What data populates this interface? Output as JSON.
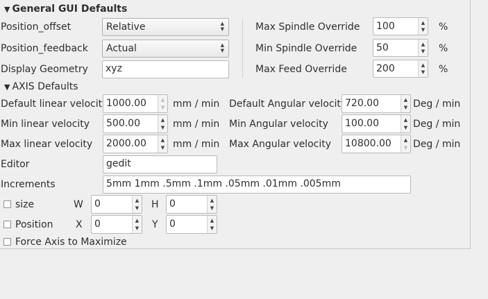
{
  "general": {
    "header": "General GUI Defaults",
    "position_offset": {
      "label": "Position_offset",
      "value": "Relative"
    },
    "position_feedback": {
      "label": "Position_feedback",
      "value": "Actual"
    },
    "display_geometry": {
      "label": "Display Geometry",
      "value": "xyz"
    },
    "max_spindle": {
      "label": "Max Spindle Override",
      "value": "100",
      "unit": "%"
    },
    "min_spindle": {
      "label": "Min Spindle Override",
      "value": "50",
      "unit": "%"
    },
    "max_feed": {
      "label": "Max Feed Override",
      "value": "200",
      "unit": "%"
    }
  },
  "axis": {
    "header": "AXIS Defaults",
    "default_linear": {
      "label": "Default linear velocity",
      "value": "1000.00",
      "unit": "mm / min"
    },
    "min_linear": {
      "label": "Min linear velocity",
      "value": "500.00",
      "unit": "mm / min"
    },
    "max_linear": {
      "label": "Max linear velocity",
      "value": "2000.00",
      "unit": "mm / min"
    },
    "default_angular": {
      "label": "Default Angular velocity",
      "value": "720.00",
      "unit": "Deg / min"
    },
    "min_angular": {
      "label": "Min Angular velocity",
      "value": "100.00",
      "unit": "Deg / min"
    },
    "max_angular": {
      "label": "Max Angular velocity",
      "value": "10800.00",
      "unit": "Deg / min"
    },
    "editor": {
      "label": "Editor",
      "value": "gedit"
    },
    "increments": {
      "label": "Increments",
      "value": "5mm 1mm .5mm .1mm .05mm .01mm .005mm"
    },
    "size": {
      "label": "size",
      "checked": false,
      "w_label": "W",
      "w_value": "0",
      "h_label": "H",
      "h_value": "0"
    },
    "position": {
      "label": "Position",
      "checked": false,
      "x_label": "X",
      "x_value": "0",
      "y_label": "Y",
      "y_value": "0"
    },
    "force_max": {
      "label": "Force Axis to Maximize",
      "checked": false
    }
  }
}
